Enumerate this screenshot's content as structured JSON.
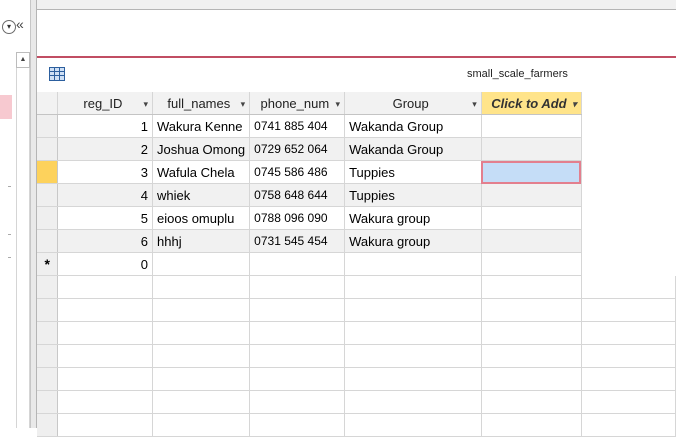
{
  "navigation": {
    "dropdown_icon": "chevron-down-icon",
    "collapse_icon": "«",
    "scroll_up_icon": "▲"
  },
  "datasheet": {
    "table_name": "small_scale_farmers",
    "columns": [
      {
        "label": "reg_ID",
        "sort_arrow": "▾"
      },
      {
        "label": "full_names",
        "sort_arrow": "▾"
      },
      {
        "label": "phone_num",
        "sort_arrow": "▾"
      },
      {
        "label": "Group",
        "sort_arrow": "▾"
      },
      {
        "label": "Click to Add",
        "sort_arrow": "▾"
      }
    ],
    "rows": [
      {
        "reg_ID": "1",
        "full_names": "Wakura Kenne",
        "phone_num": "0741 885 404",
        "Group": "Wakanda Group"
      },
      {
        "reg_ID": "2",
        "full_names": "Joshua Omong",
        "phone_num": "0729 652 064",
        "Group": "Wakanda Group"
      },
      {
        "reg_ID": "3",
        "full_names": "Wafula Chela",
        "phone_num": "0745 586 486",
        "Group": "Tuppies"
      },
      {
        "reg_ID": "4",
        "full_names": "whiek",
        "phone_num": "0758 648 644",
        "Group": "Tuppies"
      },
      {
        "reg_ID": "5",
        "full_names": "eioos omuplu",
        "phone_num": "0788 096 090",
        "Group": "Wakura group"
      },
      {
        "reg_ID": "6",
        "full_names": "hhhj",
        "phone_num": "0731 545 454",
        "Group": "Wakura group"
      }
    ],
    "new_row": {
      "marker": "*",
      "reg_ID": "0"
    }
  },
  "colors": {
    "accent_border": "#c14e63",
    "add_column": "#ffe48a",
    "current_row_selector": "#fdd25c",
    "active_cell": "#c5ddf7"
  }
}
